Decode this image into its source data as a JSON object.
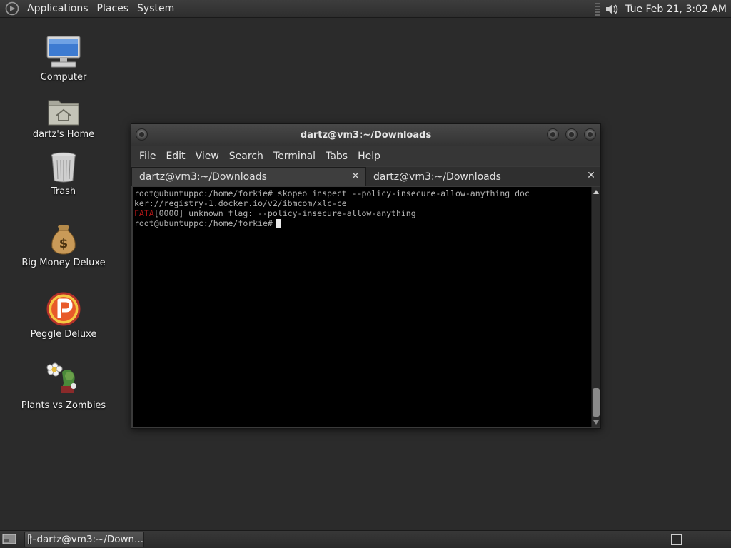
{
  "top_panel": {
    "menus": [
      "Applications",
      "Places",
      "System"
    ],
    "clock": "Tue Feb 21,  3:02 AM"
  },
  "desktop": {
    "icons": [
      {
        "label": "Computer",
        "icon": "computer-icon"
      },
      {
        "label": "dartz's Home",
        "icon": "home-folder-icon"
      },
      {
        "label": "Trash",
        "icon": "trash-icon"
      },
      {
        "label": "Big Money Deluxe",
        "icon": "money-bag-icon"
      },
      {
        "label": "Peggle Deluxe",
        "icon": "peggle-icon"
      },
      {
        "label": "Plants vs Zombies",
        "icon": "plants-vs-zombies-icon"
      }
    ]
  },
  "terminal": {
    "title": "dartz@vm3:~/Downloads",
    "menus": [
      "File",
      "Edit",
      "View",
      "Search",
      "Terminal",
      "Tabs",
      "Help"
    ],
    "tabs": [
      {
        "label": "dartz@vm3:~/Downloads",
        "active": true
      },
      {
        "label": "dartz@vm3:~/Downloads",
        "active": false
      }
    ],
    "lines": {
      "l1": "root@ubuntuppc:/home/forkie# skopeo inspect --policy-insecure-allow-anything doc",
      "l2": "ker://registry-1.docker.io/v2/ibmcom/xlc-ce",
      "l3_tag": "FATA",
      "l3_rest": "[0000] unknown flag: --policy-insecure-allow-anything",
      "l4": "root@ubuntuppc:/home/forkie#"
    },
    "colors": {
      "fata": "#b21818",
      "text": "#b4b4b4",
      "background": "#000000"
    }
  },
  "bottom_panel": {
    "task_label": "dartz@vm3:~/Down..."
  }
}
